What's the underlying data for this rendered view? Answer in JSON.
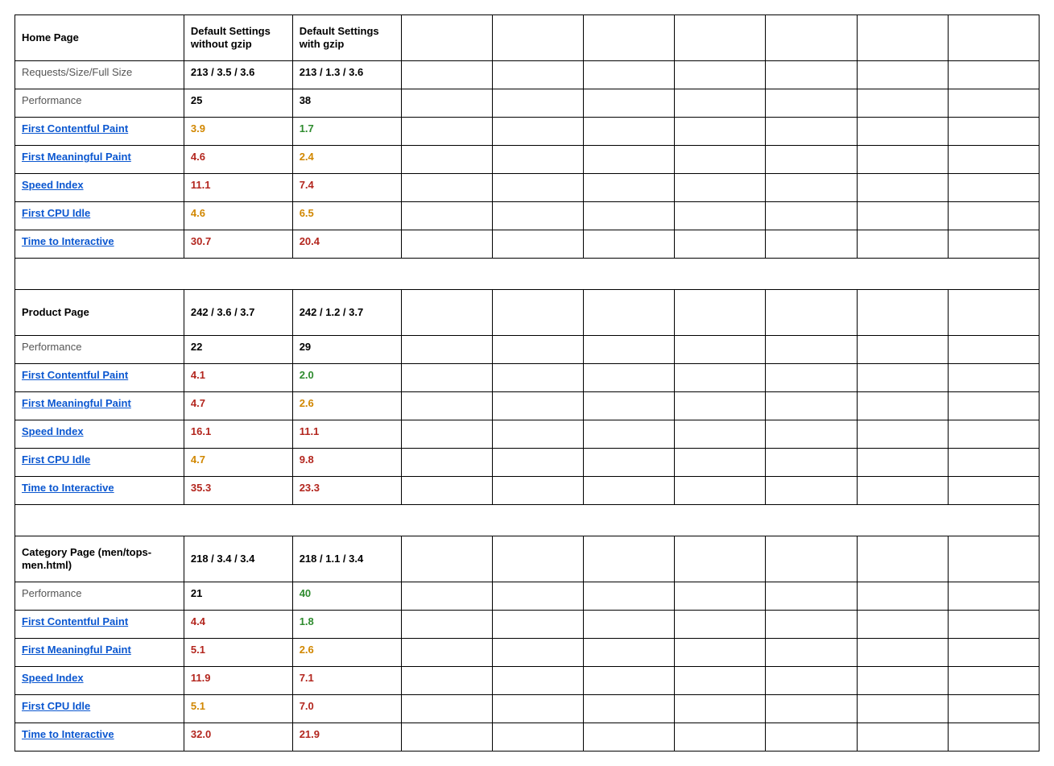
{
  "colHeaders": {
    "noGzip": "Default Settings without  gzip",
    "gzip": "Default Settings with gzip"
  },
  "metricLabels": {
    "reqSize": "Requests/Size/Full Size",
    "performance": "Performance",
    "fcp": "First Contentful Paint",
    "fmp": "First Meaningful Paint",
    "si": "Speed Index",
    "cpuIdle": "First CPU Idle",
    "tti": "Time to Interactive"
  },
  "sections": [
    {
      "title": "Home Page",
      "showReqRow": true,
      "req": {
        "noGzip": "213 / 3.5 / 3.6",
        "gzip": "213 / 1.3 / 3.6"
      },
      "rows": {
        "performance": {
          "noGzip": {
            "v": "25",
            "c": "black"
          },
          "gzip": {
            "v": "38",
            "c": "black"
          }
        },
        "fcp": {
          "noGzip": {
            "v": "3.9",
            "c": "orange"
          },
          "gzip": {
            "v": "1.7",
            "c": "green"
          }
        },
        "fmp": {
          "noGzip": {
            "v": "4.6",
            "c": "red"
          },
          "gzip": {
            "v": "2.4",
            "c": "orange"
          }
        },
        "si": {
          "noGzip": {
            "v": "11.1",
            "c": "red"
          },
          "gzip": {
            "v": "7.4",
            "c": "red"
          }
        },
        "cpuIdle": {
          "noGzip": {
            "v": "4.6",
            "c": "orange"
          },
          "gzip": {
            "v": "6.5",
            "c": "orange"
          }
        },
        "tti": {
          "noGzip": {
            "v": "30.7",
            "c": "red"
          },
          "gzip": {
            "v": "20.4",
            "c": "red"
          }
        }
      }
    },
    {
      "title": "Product Page",
      "showReqRow": false,
      "req": {
        "noGzip": "242 / 3.6 / 3.7",
        "gzip": "242 / 1.2 / 3.7"
      },
      "rows": {
        "performance": {
          "noGzip": {
            "v": "22",
            "c": "black"
          },
          "gzip": {
            "v": "29",
            "c": "black"
          }
        },
        "fcp": {
          "noGzip": {
            "v": "4.1",
            "c": "red"
          },
          "gzip": {
            "v": "2.0",
            "c": "green"
          }
        },
        "fmp": {
          "noGzip": {
            "v": "4.7",
            "c": "red"
          },
          "gzip": {
            "v": "2.6",
            "c": "orange"
          }
        },
        "si": {
          "noGzip": {
            "v": "16.1",
            "c": "red"
          },
          "gzip": {
            "v": "11.1",
            "c": "red"
          }
        },
        "cpuIdle": {
          "noGzip": {
            "v": "4.7",
            "c": "orange"
          },
          "gzip": {
            "v": "9.8",
            "c": "red"
          }
        },
        "tti": {
          "noGzip": {
            "v": "35.3",
            "c": "red"
          },
          "gzip": {
            "v": "23.3",
            "c": "red"
          }
        }
      }
    },
    {
      "title": "Category Page (men/tops-men.html)",
      "showReqRow": false,
      "req": {
        "noGzip": "218 / 3.4 / 3.4",
        "gzip": "218 / 1.1 / 3.4"
      },
      "rows": {
        "performance": {
          "noGzip": {
            "v": "21",
            "c": "black"
          },
          "gzip": {
            "v": "40",
            "c": "green"
          }
        },
        "fcp": {
          "noGzip": {
            "v": "4.4",
            "c": "red"
          },
          "gzip": {
            "v": "1.8",
            "c": "green"
          }
        },
        "fmp": {
          "noGzip": {
            "v": "5.1",
            "c": "red"
          },
          "gzip": {
            "v": "2.6",
            "c": "orange"
          }
        },
        "si": {
          "noGzip": {
            "v": "11.9",
            "c": "red"
          },
          "gzip": {
            "v": "7.1",
            "c": "red"
          }
        },
        "cpuIdle": {
          "noGzip": {
            "v": "5.1",
            "c": "orange"
          },
          "gzip": {
            "v": "7.0",
            "c": "red"
          }
        },
        "tti": {
          "noGzip": {
            "v": "32.0",
            "c": "red"
          },
          "gzip": {
            "v": "21.9",
            "c": "red"
          }
        }
      }
    }
  ],
  "chart_data": {
    "type": "table",
    "columns": [
      "Default Settings without gzip",
      "Default Settings with gzip"
    ],
    "groups": [
      {
        "name": "Home Page",
        "rows": [
          {
            "metric": "Requests/Size/Full Size",
            "noGzip": "213 / 3.5 / 3.6",
            "gzip": "213 / 1.3 / 3.6"
          },
          {
            "metric": "Performance",
            "noGzip": 25,
            "gzip": 38
          },
          {
            "metric": "First Contentful Paint",
            "noGzip": 3.9,
            "gzip": 1.7
          },
          {
            "metric": "First Meaningful Paint",
            "noGzip": 4.6,
            "gzip": 2.4
          },
          {
            "metric": "Speed Index",
            "noGzip": 11.1,
            "gzip": 7.4
          },
          {
            "metric": "First CPU Idle",
            "noGzip": 4.6,
            "gzip": 6.5
          },
          {
            "metric": "Time to Interactive",
            "noGzip": 30.7,
            "gzip": 20.4
          }
        ]
      },
      {
        "name": "Product Page",
        "rows": [
          {
            "metric": "Requests/Size/Full Size",
            "noGzip": "242 / 3.6 / 3.7",
            "gzip": "242 / 1.2 / 3.7"
          },
          {
            "metric": "Performance",
            "noGzip": 22,
            "gzip": 29
          },
          {
            "metric": "First Contentful Paint",
            "noGzip": 4.1,
            "gzip": 2.0
          },
          {
            "metric": "First Meaningful Paint",
            "noGzip": 4.7,
            "gzip": 2.6
          },
          {
            "metric": "Speed Index",
            "noGzip": 16.1,
            "gzip": 11.1
          },
          {
            "metric": "First CPU Idle",
            "noGzip": 4.7,
            "gzip": 9.8
          },
          {
            "metric": "Time to Interactive",
            "noGzip": 35.3,
            "gzip": 23.3
          }
        ]
      },
      {
        "name": "Category Page (men/tops-men.html)",
        "rows": [
          {
            "metitic": "Requests/Size/Full Size",
            "noGzip": "218 / 3.4 / 3.4",
            "gzip": "218 / 1.1 / 3.4"
          },
          {
            "metric": "Performance",
            "noGzip": 21,
            "gzip": 40
          },
          {
            "metric": "First Contentful Paint",
            "noGzip": 4.4,
            "gzip": 1.8
          },
          {
            "metric": "First Meaningful Paint",
            "noGzip": 5.1,
            "gzip": 2.6
          },
          {
            "metric": "Speed Index",
            "noGzip": 11.9,
            "gzip": 7.1
          },
          {
            "metric": "First CPU Idle",
            "noGzip": 5.1,
            "gzip": 7.0
          },
          {
            "metric": "Time to Interactive",
            "noGzip": 32.0,
            "gzip": 21.9
          }
        ]
      }
    ]
  }
}
